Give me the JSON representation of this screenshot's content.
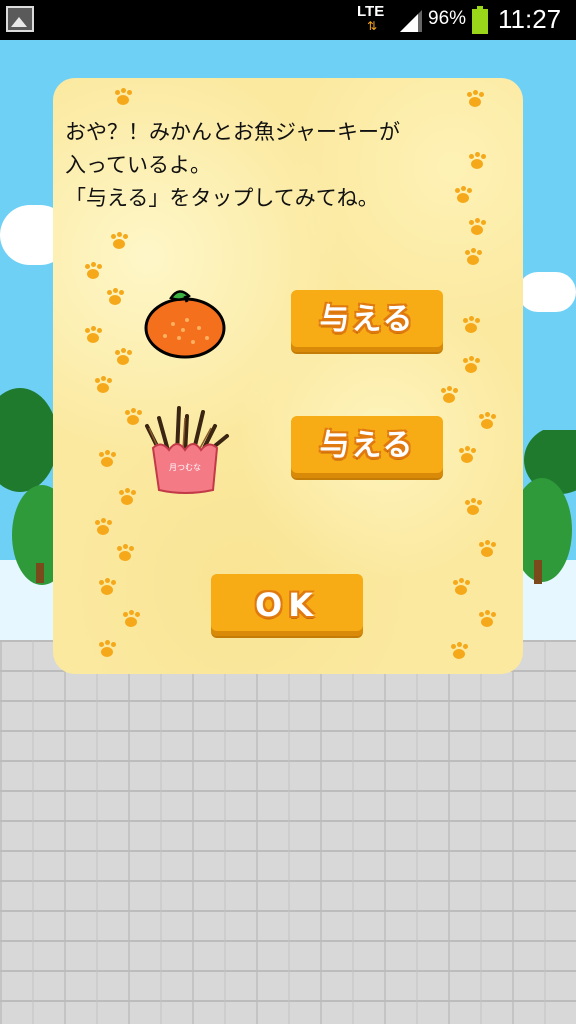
{
  "status_bar": {
    "network": "LTE",
    "battery_percent": "96%",
    "time": "11:27",
    "icons": [
      "gallery-icon",
      "lte-data-icon",
      "signal-icon",
      "battery-icon"
    ]
  },
  "dialog": {
    "message": "おや？！みかんとお魚ジャーキーが\n入っているよ。\n「与える」をタップしてみてね。",
    "items": [
      {
        "icon": "mandarin-orange-icon",
        "button_label": "与える"
      },
      {
        "icon": "fish-jerky-icon",
        "button_label": "与える"
      }
    ],
    "ok_label": "OK"
  },
  "colors": {
    "button": "#f7ab14",
    "dialog_bg": "#fbe9a0",
    "paw": "#f5a91a",
    "sky": "#6fd0f6"
  }
}
